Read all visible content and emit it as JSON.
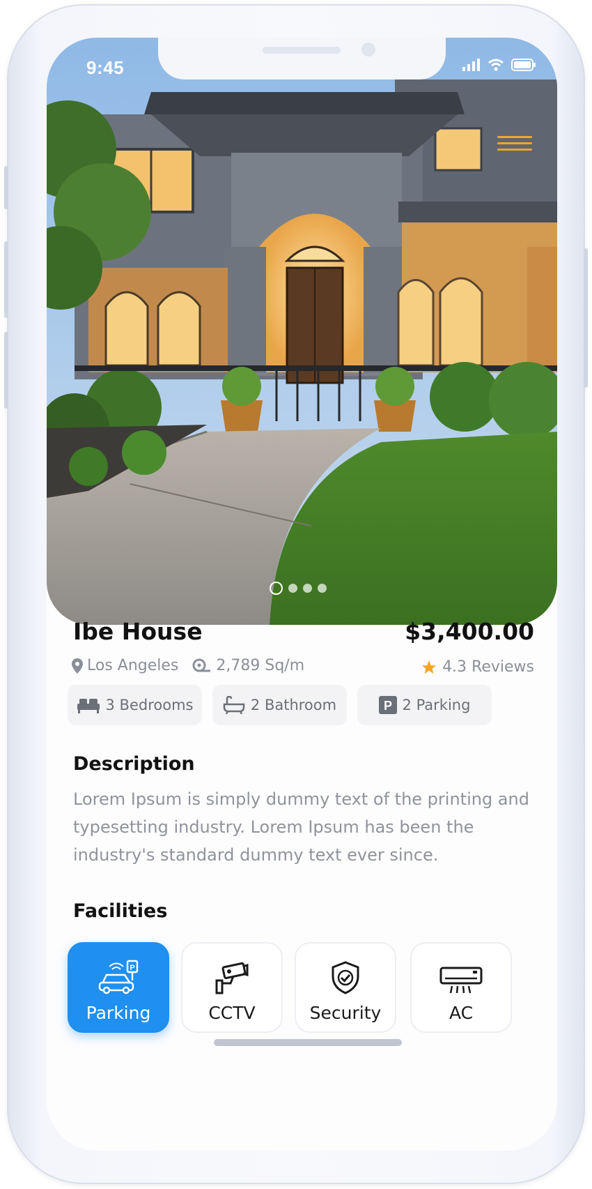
{
  "status_bar": {
    "time": "9:45"
  },
  "property": {
    "name": "Ibe House",
    "price": "$3,400.00",
    "location": "Los Angeles",
    "area": "2,789 Sq/m",
    "rating_text": "4.3 Reviews"
  },
  "features": [
    {
      "label": "3 Bedrooms",
      "icon": "bed-icon"
    },
    {
      "label": "2 Bathroom",
      "icon": "bathtub-icon"
    },
    {
      "label": "2 Parking",
      "icon": "parking-icon"
    }
  ],
  "description": {
    "heading": "Description",
    "text": "Lorem Ipsum is simply dummy text of the printing and typesetting industry. Lorem Ipsum has been the industry's standard dummy text ever since."
  },
  "facilities": {
    "heading": "Facilities",
    "items": [
      {
        "label": "Parking",
        "icon": "car-parking-icon",
        "active": true
      },
      {
        "label": "CCTV",
        "icon": "cctv-camera-icon",
        "active": false
      },
      {
        "label": "Security",
        "icon": "shield-check-icon",
        "active": false
      },
      {
        "label": "AC",
        "icon": "air-conditioner-icon",
        "active": false
      }
    ]
  },
  "carousel": {
    "total": 4,
    "active_index": 0
  },
  "colors": {
    "accent": "#1f8ff0",
    "star": "#f5a524",
    "menu": "#f5a524"
  }
}
